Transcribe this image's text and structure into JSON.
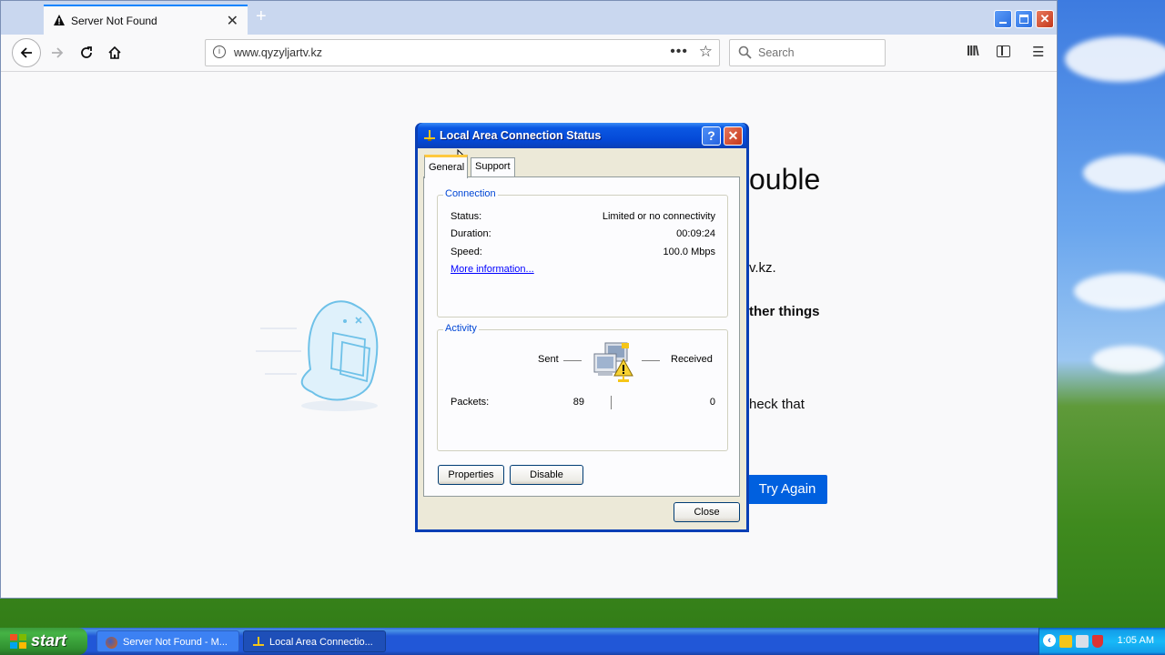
{
  "browser": {
    "tab_title": "Server Not Found",
    "url": "www.qyzyljartv.kz",
    "search_placeholder": "Search",
    "page": {
      "heading_fragment": "ouble",
      "line1_fragment": "v.kz.",
      "line2_fragment": "ther things",
      "line3_fragment": "heck that",
      "try_again_label": "Try Again"
    }
  },
  "dialog": {
    "title": "Local Area Connection Status",
    "help_label": "?",
    "tabs": [
      "General",
      "Support"
    ],
    "connection": {
      "group_label": "Connection",
      "rows": [
        {
          "label": "Status:",
          "value": "Limited or no connectivity"
        },
        {
          "label": "Duration:",
          "value": "00:09:24"
        },
        {
          "label": "Speed:",
          "value": "100.0 Mbps"
        }
      ],
      "more_info_link": "More information..."
    },
    "activity": {
      "group_label": "Activity",
      "sent_label": "Sent",
      "received_label": "Received",
      "packets_label": "Packets:",
      "packets_sent": "89",
      "packets_received": "0"
    },
    "buttons": {
      "properties": "Properties",
      "disable": "Disable",
      "close": "Close"
    }
  },
  "taskbar": {
    "start_label": "start",
    "items": [
      "Server Not Found - M...",
      "Local Area Connectio..."
    ],
    "clock": "1:05 AM"
  }
}
